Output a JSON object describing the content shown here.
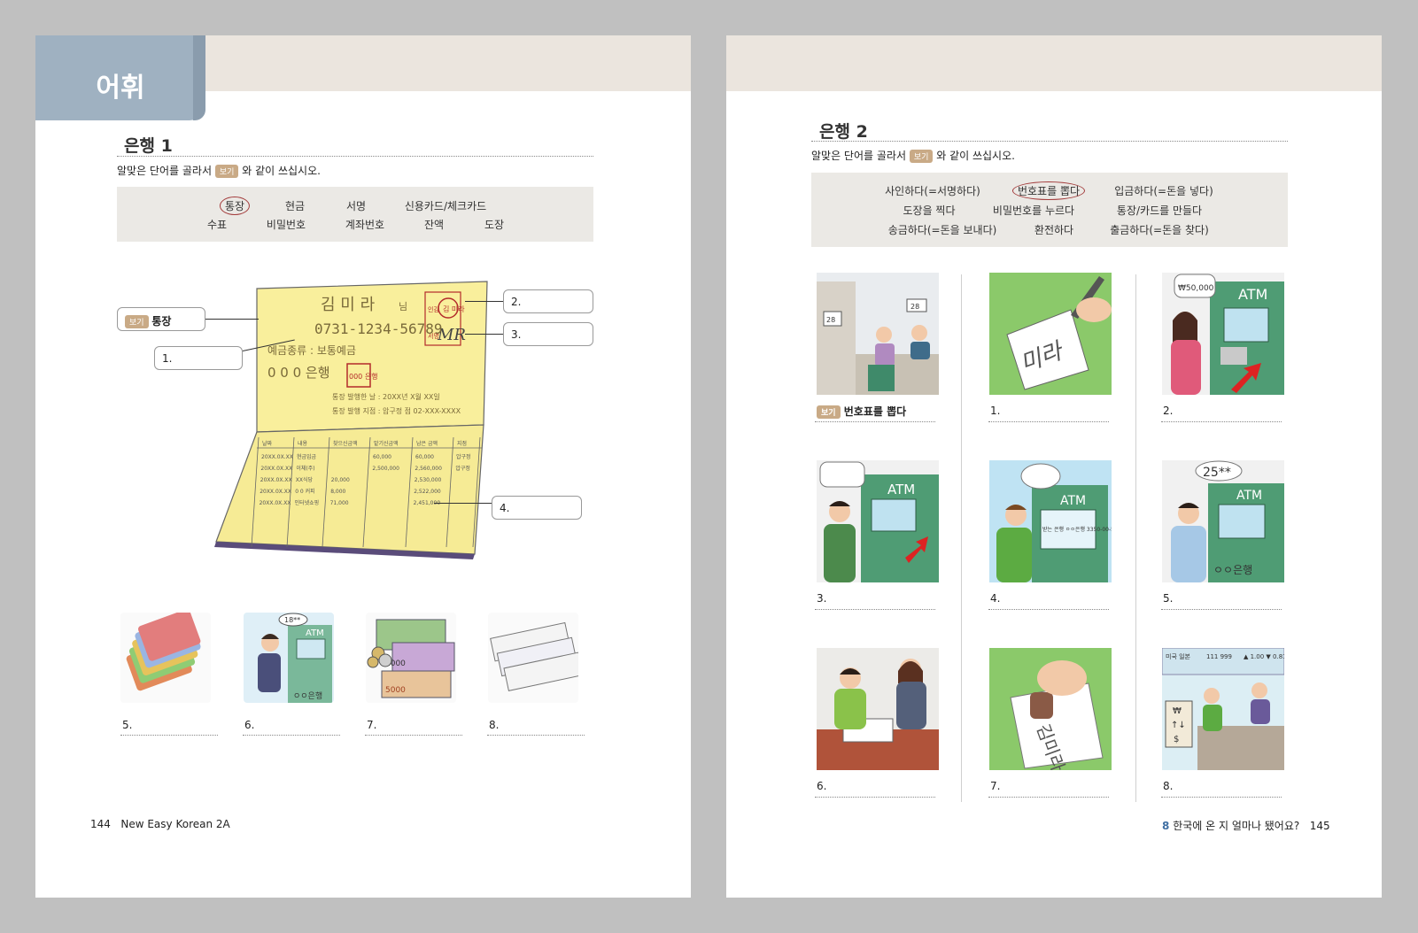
{
  "left_page": {
    "tab_label": "어휘",
    "section_title": "은행 1",
    "instruction_prefix": "알맞은 단어를 골라서",
    "badge_label": "보기",
    "instruction_suffix": "와 같이 쓰십시오.",
    "word_bank_row1": [
      "통장",
      "현금",
      "서명",
      "신용카드/체크카드"
    ],
    "word_bank_row2": [
      "수표",
      "비밀번호",
      "계좌번호",
      "잔액",
      "도장"
    ],
    "example_answer": "통장",
    "labels": [
      "1.",
      "2.",
      "3.",
      "4."
    ],
    "passbook": {
      "name": "김 미 라",
      "name_suffix": "님",
      "account_number": "0731-1234-56789",
      "account_type": "예금종류 : 보통예금",
      "bank": "0 0 0 은행",
      "bank_seal": "000 은행",
      "stamp": "김 미라",
      "stamp_side": "인감",
      "signature": "MR",
      "signature_side": "서명",
      "issue_date": "통장 발행한 날 : 20XX년 X월 XX일",
      "issue_branch": "통장 발행 지점 : 압구정 점 02-XXX-XXXX",
      "table_headers": [
        "날짜",
        "내용",
        "찾으신금액",
        "맡기신금액",
        "남은 금액",
        "지점"
      ],
      "table_rows": [
        [
          "20XX.0X.XX",
          "현금입금",
          "",
          "60,000",
          "60,000",
          "압구정"
        ],
        [
          "20XX.0X.XX",
          "이체(주)",
          "",
          "2,500,000",
          "2,560,000",
          "압구정"
        ],
        [
          "20XX.0X.XX",
          "XX식당",
          "20,000",
          "",
          "2,530,000",
          ""
        ],
        [
          "20XX.0X.XX",
          "0 0 커피",
          "8,000",
          "",
          "2,522,000",
          ""
        ],
        [
          "20XX.0X.XX",
          "인터넷쇼핑",
          "71,000",
          "",
          "2,451,000",
          ""
        ]
      ]
    },
    "thumb_labels": [
      "5.",
      "6.",
      "7.",
      "8."
    ],
    "thumb_texts": {
      "atm_bubble": "18**",
      "atm_sign": "ATM",
      "atm_bank": "ㅇㅇ은행",
      "bill": "1000",
      "bill2": "5000"
    },
    "footer_page": "144",
    "footer_title": "New Easy Korean 2A"
  },
  "right_page": {
    "section_title": "은행 2",
    "instruction_prefix": "알맞은 단어를 골라서",
    "badge_label": "보기",
    "instruction_suffix": "와 같이 쓰십시오.",
    "word_bank_row1": [
      "사인하다(=서명하다)",
      "번호표를 뽑다",
      "입금하다(=돈을 넣다)"
    ],
    "word_bank_row2": [
      "도장을 찍다",
      "비밀번호를 누르다",
      "통장/카드를 만들다"
    ],
    "word_bank_row3": [
      "송금하다(=돈을 보내다)",
      "환전하다",
      "출금하다(=돈을 찾다)"
    ],
    "example_answer": "번호표를 뽑다",
    "pic_labels": [
      "1.",
      "2.",
      "3.",
      "4.",
      "5.",
      "6.",
      "7.",
      "8."
    ],
    "pic_texts": {
      "ticket1": "28",
      "ticket2": "28",
      "paper1": "미라",
      "bubble2": "₩50,000",
      "atm": "ATM",
      "atm_bank": "ㅇㅇ은행",
      "bubble5": "25**",
      "screen4": "받는 은행 ㅇㅇ은행 3350-00-550",
      "paper7": "김미라",
      "rate_head": "미국 일본",
      "rate_vals": "111 999",
      "rate_right": "▲ 1.00 ▼ 0.81",
      "exch_won": "₩",
      "exch_arrows": "↑↓",
      "exch_dollar": "$"
    },
    "footer_chapter_num": "8",
    "footer_chapter_title": "한국에 온 지 얼마나 됐어요?",
    "footer_page": "145"
  },
  "colors": {
    "tab": "#9fb1c1",
    "band": "#ebe5de",
    "badge": "#c9aa86",
    "passbook": "#f9ef9c",
    "stamp": "#b32b2b",
    "pic_green": "#8bc96a",
    "atm_green": "#4f9c74"
  }
}
